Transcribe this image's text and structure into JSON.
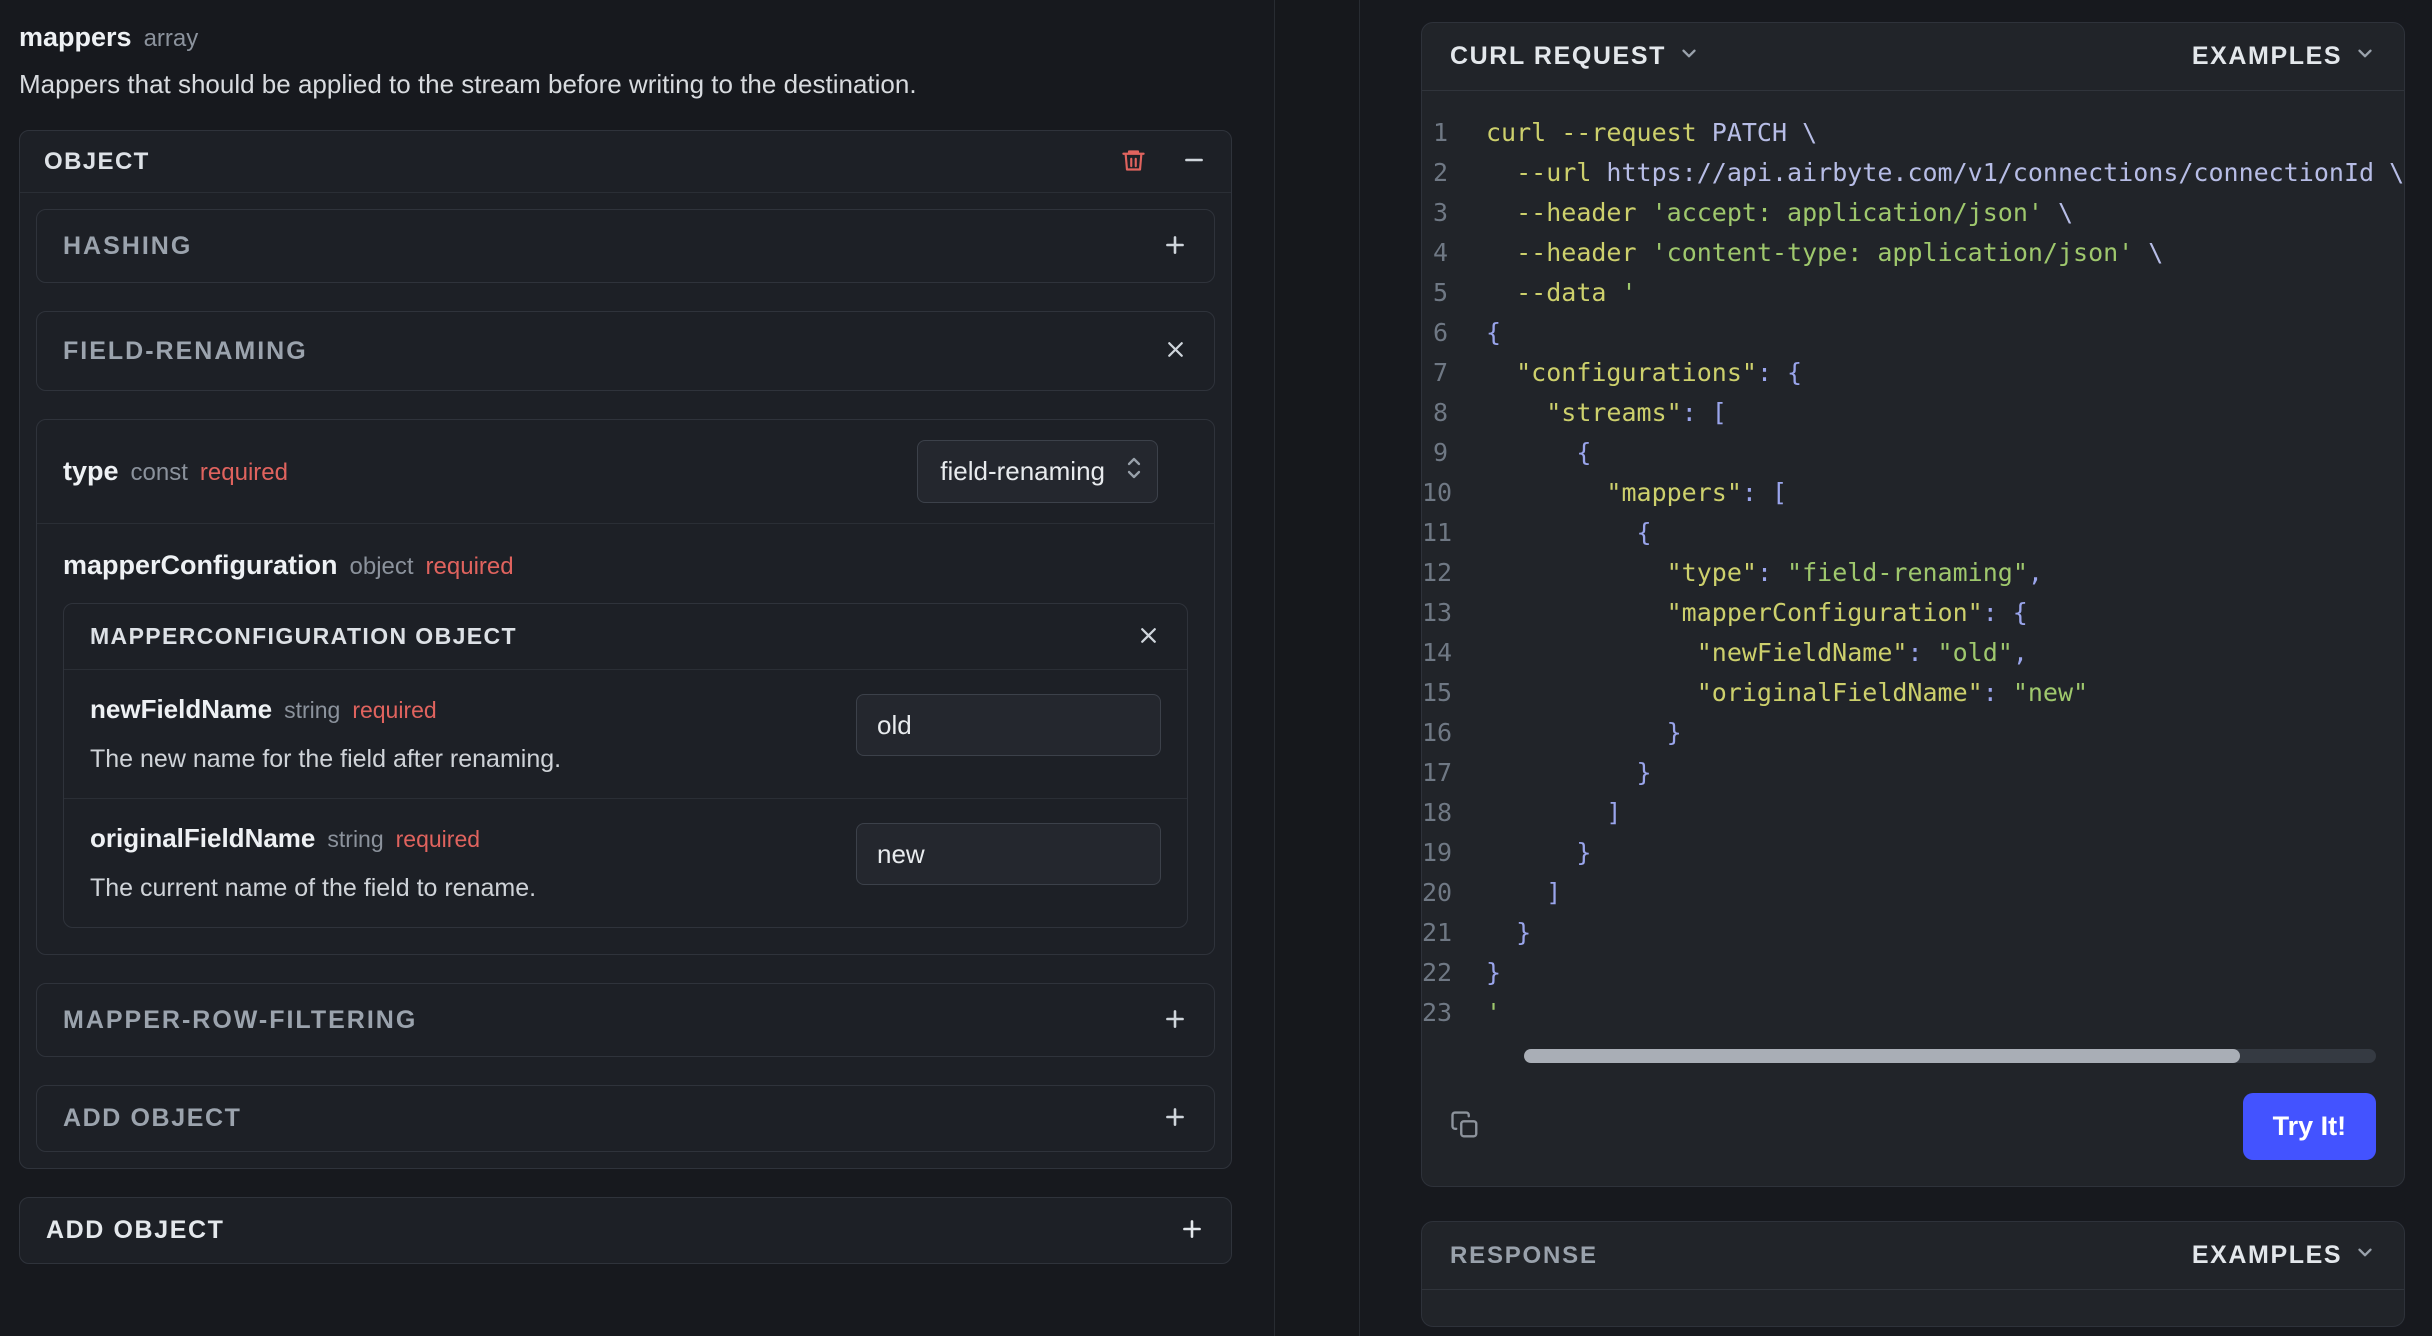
{
  "colors": {
    "accent_blue": "#4353ff",
    "required_red": "#e0635e"
  },
  "left": {
    "field_name": "mappers",
    "field_type": "array",
    "description": "Mappers that should be applied to the stream before writing to the destination.",
    "object_card": {
      "title": "OBJECT"
    },
    "hashing": {
      "title": "HASHING"
    },
    "field_renaming": {
      "title": "FIELD-RENAMING",
      "type_field": {
        "name": "type",
        "kind": "const",
        "required": "required",
        "value": "field-renaming"
      },
      "mapper_configuration": {
        "name": "mapperConfiguration",
        "kind": "object",
        "required": "required",
        "card_title": "MAPPERCONFIGURATION OBJECT",
        "fields": [
          {
            "name": "newFieldName",
            "kind": "string",
            "required": "required",
            "value": "old",
            "description": "The new name for the field after renaming."
          },
          {
            "name": "originalFieldName",
            "kind": "string",
            "required": "required",
            "value": "new",
            "description": "The current name of the field to rename."
          }
        ]
      }
    },
    "mapper_row_filtering": {
      "title": "MAPPER-ROW-FILTERING"
    },
    "add_object_inner": {
      "title": "ADD OBJECT"
    },
    "add_object_outer": {
      "title": "ADD OBJECT"
    }
  },
  "request_panel": {
    "title": "CURL REQUEST",
    "examples_label": "EXAMPLES",
    "try_button": "Try It!",
    "code": {
      "lines": [
        [
          {
            "c": "kw",
            "v": "curl --request"
          },
          {
            "c": "pl",
            "v": " PATCH \\"
          }
        ],
        [
          {
            "c": "pl",
            "v": "  "
          },
          {
            "c": "kw",
            "v": "--url"
          },
          {
            "c": "pl",
            "v": " https://api.airbyte.com/v1/connections/connectionId \\"
          }
        ],
        [
          {
            "c": "pl",
            "v": "  "
          },
          {
            "c": "kw",
            "v": "--header"
          },
          {
            "c": "pl",
            "v": " "
          },
          {
            "c": "str",
            "v": "'accept: application/json'"
          },
          {
            "c": "pl",
            "v": " \\"
          }
        ],
        [
          {
            "c": "pl",
            "v": "  "
          },
          {
            "c": "kw",
            "v": "--header"
          },
          {
            "c": "pl",
            "v": " "
          },
          {
            "c": "str",
            "v": "'content-type: application/json'"
          },
          {
            "c": "pl",
            "v": " \\"
          }
        ],
        [
          {
            "c": "pl",
            "v": "  "
          },
          {
            "c": "kw",
            "v": "--data"
          },
          {
            "c": "pl",
            "v": " "
          },
          {
            "c": "str",
            "v": "'"
          }
        ],
        [
          {
            "c": "pu",
            "v": "{"
          }
        ],
        [
          {
            "c": "pl",
            "v": "  "
          },
          {
            "c": "key",
            "v": "\"configurations\""
          },
          {
            "c": "pu",
            "v": ": {"
          }
        ],
        [
          {
            "c": "pl",
            "v": "    "
          },
          {
            "c": "key",
            "v": "\"streams\""
          },
          {
            "c": "pu",
            "v": ": ["
          }
        ],
        [
          {
            "c": "pl",
            "v": "      "
          },
          {
            "c": "pu",
            "v": "{"
          }
        ],
        [
          {
            "c": "pl",
            "v": "        "
          },
          {
            "c": "key",
            "v": "\"mappers\""
          },
          {
            "c": "pu",
            "v": ": ["
          }
        ],
        [
          {
            "c": "pl",
            "v": "          "
          },
          {
            "c": "pu",
            "v": "{"
          }
        ],
        [
          {
            "c": "pl",
            "v": "            "
          },
          {
            "c": "key",
            "v": "\"type\""
          },
          {
            "c": "pu",
            "v": ": "
          },
          {
            "c": "str",
            "v": "\"field-renaming\""
          },
          {
            "c": "pu",
            "v": ","
          }
        ],
        [
          {
            "c": "pl",
            "v": "            "
          },
          {
            "c": "key",
            "v": "\"mapperConfiguration\""
          },
          {
            "c": "pu",
            "v": ": {"
          }
        ],
        [
          {
            "c": "pl",
            "v": "              "
          },
          {
            "c": "key",
            "v": "\"newFieldName\""
          },
          {
            "c": "pu",
            "v": ": "
          },
          {
            "c": "str",
            "v": "\"old\""
          },
          {
            "c": "pu",
            "v": ","
          }
        ],
        [
          {
            "c": "pl",
            "v": "              "
          },
          {
            "c": "key",
            "v": "\"originalFieldName\""
          },
          {
            "c": "pu",
            "v": ": "
          },
          {
            "c": "str",
            "v": "\"new\""
          }
        ],
        [
          {
            "c": "pl",
            "v": "            "
          },
          {
            "c": "pu",
            "v": "}"
          }
        ],
        [
          {
            "c": "pl",
            "v": "          "
          },
          {
            "c": "pu",
            "v": "}"
          }
        ],
        [
          {
            "c": "pl",
            "v": "        "
          },
          {
            "c": "pu",
            "v": "]"
          }
        ],
        [
          {
            "c": "pl",
            "v": "      "
          },
          {
            "c": "pu",
            "v": "}"
          }
        ],
        [
          {
            "c": "pl",
            "v": "    "
          },
          {
            "c": "pu",
            "v": "]"
          }
        ],
        [
          {
            "c": "pl",
            "v": "  "
          },
          {
            "c": "pu",
            "v": "}"
          }
        ],
        [
          {
            "c": "pu",
            "v": "}"
          }
        ],
        [
          {
            "c": "str",
            "v": "'"
          }
        ]
      ]
    }
  },
  "response_panel": {
    "title": "RESPONSE",
    "examples_label": "EXAMPLES"
  }
}
